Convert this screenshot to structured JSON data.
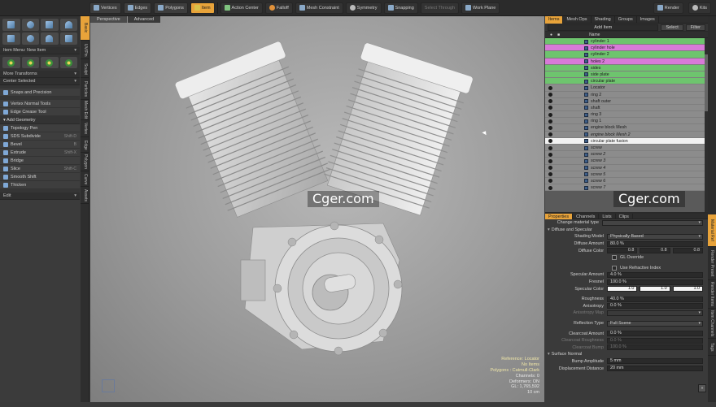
{
  "topbar": {
    "tools": [
      {
        "label": "Vertices",
        "icon": "vertex-icon"
      },
      {
        "label": "Edges",
        "icon": "edge-icon"
      },
      {
        "label": "Polygons",
        "icon": "polygon-icon"
      },
      {
        "label": "Item",
        "icon": "item-icon",
        "active": true
      }
    ],
    "action_center": "Action Center",
    "falloff": "Falloff",
    "mesh_constraint": "Mesh Constraint",
    "symmetry": "Symmetry",
    "snapping": "Snapping",
    "select_through": "Select Through",
    "work_plane": "Work Plane",
    "render": "Render",
    "kits": "Kits"
  },
  "left_panel": {
    "item_menu": "Item Menu: New Item",
    "more_transforms": "More Transforms",
    "center_selected": "Center Selected",
    "snaps_precision": "Snaps and Precision",
    "vertex_normal_tools": "Vertex Normal Tools",
    "edge_crease_tool": "Edge Crease Tool",
    "add_geometry": "Add Geometry",
    "tools": [
      {
        "label": "Topology Pen",
        "shortcut": ""
      },
      {
        "label": "SDS Subdivide",
        "shortcut": "Shift-D"
      },
      {
        "label": "Bevel",
        "shortcut": "B"
      },
      {
        "label": "Extrude",
        "shortcut": "Shift-X"
      },
      {
        "label": "Bridge",
        "shortcut": ""
      },
      {
        "label": "Slice",
        "shortcut": "Shift-C"
      },
      {
        "label": "Smooth Shift",
        "shortcut": ""
      },
      {
        "label": "Thicken",
        "shortcut": ""
      }
    ],
    "edit_dropdown": "Edit",
    "vertical_tabs": [
      "Basic",
      "UV/Pin",
      "Sculpt",
      "Particles",
      "Mesh Edit",
      "Vertex",
      "Edge",
      "Polygon",
      "Curve",
      "Assets"
    ]
  },
  "viewport": {
    "tabs": [
      "Perspective",
      "Advanced"
    ],
    "info": {
      "reference": "Reference: Locator",
      "items": "No Items",
      "polygons": "Polygons : Catmull-Clark",
      "channels": "Channels: 0",
      "deformers": "Deformers: ON",
      "gl": "GL: 1,765,592",
      "units": "10 cm"
    },
    "watermark": "Cger.com"
  },
  "right_panel": {
    "top_tabs": [
      "Items",
      "Mesh Ops",
      "Shading",
      "Groups",
      "Images"
    ],
    "add_item": "Add Item",
    "select_button": "Select",
    "filter_button": "Filter",
    "name_column": "Name",
    "items": [
      {
        "name": "cylinder 1",
        "style": "green"
      },
      {
        "name": "cylinder hole",
        "style": "pink"
      },
      {
        "name": "cylinder 2",
        "style": "green"
      },
      {
        "name": "holes 2",
        "style": "pink"
      },
      {
        "name": "sides",
        "style": "green"
      },
      {
        "name": "side plate",
        "style": "green"
      },
      {
        "name": "circular plate",
        "style": "green"
      },
      {
        "name": "Locator",
        "style": "grey"
      },
      {
        "name": "ring 2",
        "style": "grey"
      },
      {
        "name": "shaft outer",
        "style": "grey"
      },
      {
        "name": "shaft",
        "style": "grey"
      },
      {
        "name": "ring 3",
        "style": "grey"
      },
      {
        "name": "ring 1",
        "style": "grey"
      },
      {
        "name": "engine block Mesh",
        "style": "grey"
      },
      {
        "name": "engine block Mesh 2",
        "style": "grey-italic"
      },
      {
        "name": "circular plate fusion",
        "style": "white"
      },
      {
        "name": "screw",
        "style": "grey-italic"
      },
      {
        "name": "screw 2",
        "style": "grey-italic"
      },
      {
        "name": "screw 3",
        "style": "grey-italic"
      },
      {
        "name": "screw 4",
        "style": "grey-italic"
      },
      {
        "name": "screw 5",
        "style": "grey-italic"
      },
      {
        "name": "screw 6",
        "style": "grey-italic"
      },
      {
        "name": "screw 7",
        "style": "grey-italic"
      }
    ],
    "watermark": "Cger.com",
    "props_tabs": [
      "Properties",
      "Channels",
      "Lists",
      "Clips"
    ],
    "props": {
      "change_material_type": "Change material type",
      "diffuse_section": "Diffuse and Specular",
      "shading_model_label": "Shading Model",
      "shading_model_value": "Physically Based",
      "diffuse_amount_label": "Diffuse Amount",
      "diffuse_amount_value": "80.0 %",
      "diffuse_color_label": "Diffuse Color",
      "diffuse_color_values": [
        "0.8",
        "0.8",
        "0.8"
      ],
      "gl_override": "GL Override",
      "use_refractive_index": "Use Refractive Index",
      "specular_amount_label": "Specular Amount",
      "specular_amount_value": "4.0 %",
      "fresnel_label": "Fresnel",
      "fresnel_value": "100.0 %",
      "specular_color_label": "Specular Color",
      "specular_color_values": [
        "1.0",
        "1.0",
        "1.0"
      ],
      "roughness_label": "Roughness",
      "roughness_value": "40.0 %",
      "anisotropy_label": "Anisotropy",
      "anisotropy_value": "0.0 %",
      "anisotropy_map_label": "Anisotropy Map",
      "reflection_type_label": "Reflection Type",
      "reflection_type_value": "Full Scene",
      "clearcoat_amount_label": "Clearcoat Amount",
      "clearcoat_amount_value": "0.0 %",
      "clearcoat_roughness_label": "Clearcoat Roughness",
      "clearcoat_roughness_value": "0.0 %",
      "clearcoat_bump_label": "Clearcoat Bump",
      "clearcoat_bump_value": "100.0 %",
      "surface_normal_section": "Surface Normal",
      "bump_amplitude_label": "Bump Amplitude",
      "bump_amplitude_value": "5 mm",
      "displacement_distance_label": "Displacement Distance",
      "displacement_distance_value": "20 mm"
    },
    "vertical_tabs": [
      "Material Ref",
      "Render Preset",
      "Render Items",
      "Item Channels",
      "Tags"
    ]
  }
}
